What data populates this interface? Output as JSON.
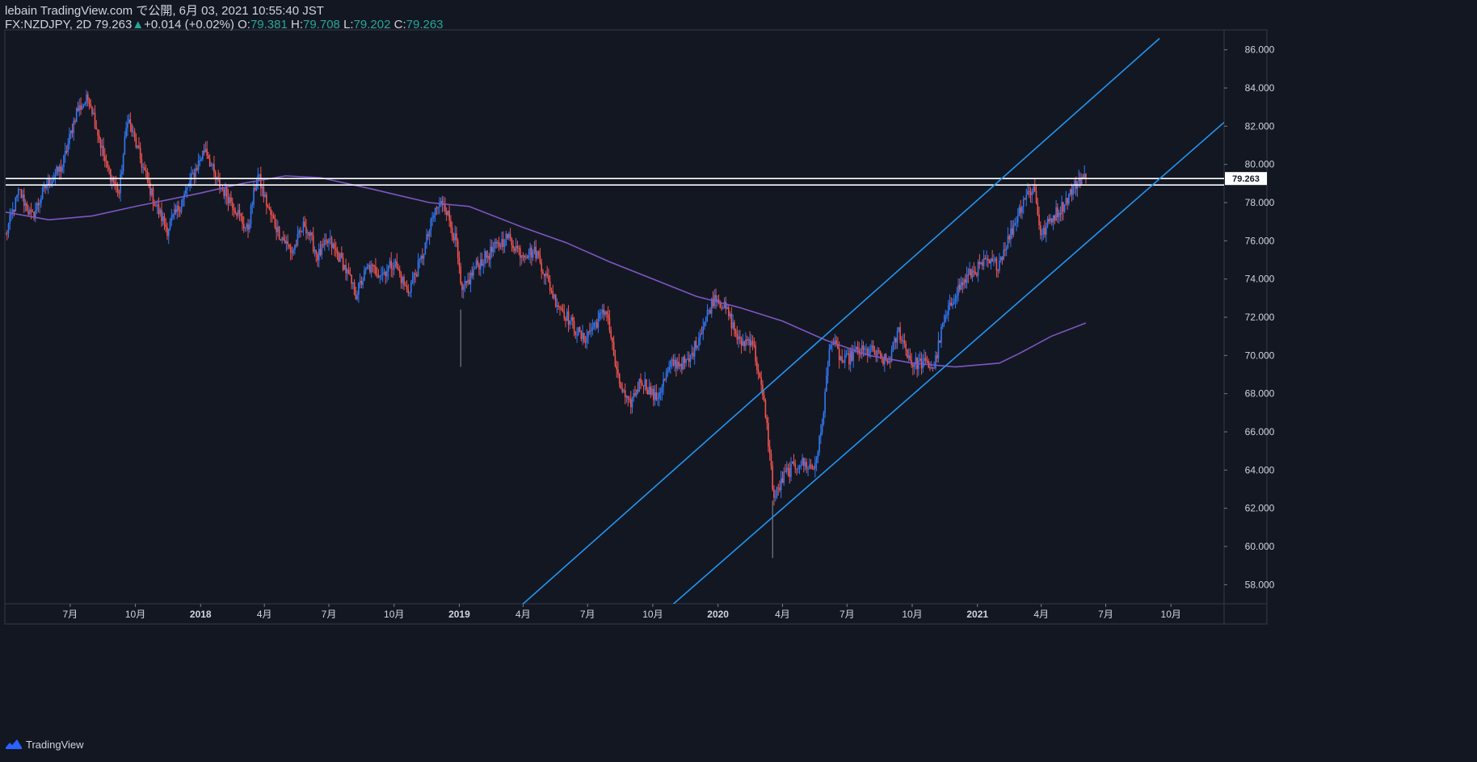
{
  "header": {
    "published": "lebain TradingView.com で公開, 6月 03, 2021 10:55:40 JST",
    "symbol": "FX:NZDJPY, 2D",
    "last": "79.263",
    "change_arrow": "▲",
    "change": "+0.014 (+0.02%)",
    "o_label": "O:",
    "o": "79.381",
    "h_label": "H:",
    "h": "79.708",
    "l_label": "L:",
    "l": "79.202",
    "c_label": "C:",
    "c": "79.263"
  },
  "footer": {
    "brand": "TradingView"
  },
  "colors": {
    "background": "#131722",
    "up": "#3179f5",
    "down": "#f0544f",
    "ma": "#7e57c2",
    "channel": "#2196f3",
    "hline": "#ffffff",
    "axis_text": "#d1d4dc",
    "value_green": "#26a69a"
  },
  "chart_data": {
    "type": "candlestick",
    "symbol": "FX:NZDJPY",
    "timeframe": "2D",
    "y_range": [
      57,
      87
    ],
    "y_ticks": [
      86,
      84,
      82,
      80,
      78,
      76,
      74,
      72,
      70,
      68,
      66,
      64,
      62,
      60,
      58
    ],
    "y_tick_labels": [
      "86.000",
      "84.000",
      "82.000",
      "80.000",
      "78.000",
      "76.000",
      "74.000",
      "72.000",
      "70.000",
      "68.000",
      "66.000",
      "64.000",
      "62.000",
      "60.000",
      "58.000"
    ],
    "x_range": [
      "2017-04-01",
      "2021-12-15"
    ],
    "x_ticks": [
      {
        "date": "2017-07-01",
        "label": "7月",
        "bold": false
      },
      {
        "date": "2017-10-01",
        "label": "10月",
        "bold": false
      },
      {
        "date": "2018-01-01",
        "label": "2018",
        "bold": true
      },
      {
        "date": "2018-04-01",
        "label": "4月",
        "bold": false
      },
      {
        "date": "2018-07-01",
        "label": "7月",
        "bold": false
      },
      {
        "date": "2018-10-01",
        "label": "10月",
        "bold": false
      },
      {
        "date": "2019-01-01",
        "label": "2019",
        "bold": true
      },
      {
        "date": "2019-04-01",
        "label": "4月",
        "bold": false
      },
      {
        "date": "2019-07-01",
        "label": "7月",
        "bold": false
      },
      {
        "date": "2019-10-01",
        "label": "10月",
        "bold": false
      },
      {
        "date": "2020-01-01",
        "label": "2020",
        "bold": true
      },
      {
        "date": "2020-04-01",
        "label": "4月",
        "bold": false
      },
      {
        "date": "2020-07-01",
        "label": "7月",
        "bold": false
      },
      {
        "date": "2020-10-01",
        "label": "10月",
        "bold": false
      },
      {
        "date": "2021-01-01",
        "label": "2021",
        "bold": true
      },
      {
        "date": "2021-04-01",
        "label": "4月",
        "bold": false
      },
      {
        "date": "2021-07-01",
        "label": "7月",
        "bold": false
      },
      {
        "date": "2021-10-01",
        "label": "10月",
        "bold": false
      }
    ],
    "price_path": [
      [
        "2017-04-01",
        76.3
      ],
      [
        "2017-04-20",
        78.6
      ],
      [
        "2017-05-08",
        77.2
      ],
      [
        "2017-05-28",
        78.9
      ],
      [
        "2017-06-20",
        79.9
      ],
      [
        "2017-07-10",
        82.8
      ],
      [
        "2017-07-28",
        83.5
      ],
      [
        "2017-08-20",
        80.0
      ],
      [
        "2017-09-08",
        78.5
      ],
      [
        "2017-09-20",
        82.5
      ],
      [
        "2017-10-12",
        79.8
      ],
      [
        "2017-10-28",
        78.0
      ],
      [
        "2017-11-15",
        76.6
      ],
      [
        "2017-12-05",
        78.0
      ],
      [
        "2017-12-22",
        79.5
      ],
      [
        "2018-01-08",
        80.9
      ],
      [
        "2018-01-22",
        79.2
      ],
      [
        "2018-02-15",
        78.0
      ],
      [
        "2018-03-08",
        76.5
      ],
      [
        "2018-03-22",
        79.5
      ],
      [
        "2018-04-08",
        77.5
      ],
      [
        "2018-04-22",
        76.4
      ],
      [
        "2018-05-10",
        75.4
      ],
      [
        "2018-05-28",
        76.9
      ],
      [
        "2018-06-15",
        75.2
      ],
      [
        "2018-07-01",
        76.0
      ],
      [
        "2018-07-20",
        74.9
      ],
      [
        "2018-08-08",
        73.2
      ],
      [
        "2018-08-25",
        74.6
      ],
      [
        "2018-09-15",
        74.3
      ],
      [
        "2018-10-01",
        74.9
      ],
      [
        "2018-10-20",
        73.3
      ],
      [
        "2018-11-08",
        75.0
      ],
      [
        "2018-11-28",
        77.6
      ],
      [
        "2018-12-10",
        78.1
      ],
      [
        "2018-12-28",
        75.8
      ],
      [
        "2019-01-04",
        73.2
      ],
      [
        "2019-01-25",
        74.7
      ],
      [
        "2019-02-20",
        75.6
      ],
      [
        "2019-03-10",
        76.2
      ],
      [
        "2019-03-28",
        75.4
      ],
      [
        "2019-04-20",
        75.4
      ],
      [
        "2019-05-15",
        73.0
      ],
      [
        "2019-06-08",
        71.7
      ],
      [
        "2019-06-25",
        70.8
      ],
      [
        "2019-07-12",
        71.7
      ],
      [
        "2019-07-28",
        72.4
      ],
      [
        "2019-08-12",
        68.8
      ],
      [
        "2019-08-28",
        67.3
      ],
      [
        "2019-09-15",
        68.8
      ],
      [
        "2019-10-05",
        67.7
      ],
      [
        "2019-10-28",
        69.6
      ],
      [
        "2019-11-20",
        69.6
      ],
      [
        "2019-12-10",
        71.5
      ],
      [
        "2019-12-28",
        73.2
      ],
      [
        "2020-01-15",
        72.2
      ],
      [
        "2020-02-01",
        70.6
      ],
      [
        "2020-02-18",
        70.9
      ],
      [
        "2020-03-08",
        67.0
      ],
      [
        "2020-03-20",
        62.5
      ],
      [
        "2020-04-05",
        63.8
      ],
      [
        "2020-04-25",
        64.4
      ],
      [
        "2020-05-15",
        64.1
      ],
      [
        "2020-05-25",
        65.8
      ],
      [
        "2020-06-08",
        70.9
      ],
      [
        "2020-06-25",
        69.6
      ],
      [
        "2020-07-15",
        70.2
      ],
      [
        "2020-08-05",
        70.2
      ],
      [
        "2020-08-28",
        69.6
      ],
      [
        "2020-09-12",
        71.3
      ],
      [
        "2020-09-30",
        69.6
      ],
      [
        "2020-10-15",
        69.6
      ],
      [
        "2020-11-01",
        69.4
      ],
      [
        "2020-11-12",
        71.4
      ],
      [
        "2020-12-01",
        73.3
      ],
      [
        "2020-12-20",
        74.2
      ],
      [
        "2021-01-10",
        74.8
      ],
      [
        "2021-01-30",
        74.8
      ],
      [
        "2021-02-18",
        76.5
      ],
      [
        "2021-03-08",
        78.3
      ],
      [
        "2021-03-22",
        78.8
      ],
      [
        "2021-04-01",
        76.2
      ],
      [
        "2021-04-15",
        77.2
      ],
      [
        "2021-05-01",
        77.8
      ],
      [
        "2021-05-15",
        78.7
      ],
      [
        "2021-05-25",
        79.3
      ],
      [
        "2021-06-03",
        79.263
      ]
    ],
    "spikes": [
      {
        "date": "2019-01-03",
        "low": 69.4
      },
      {
        "date": "2020-03-18",
        "low": 59.4
      }
    ],
    "moving_average": [
      [
        "2017-04-01",
        77.5
      ],
      [
        "2017-06-01",
        77.1
      ],
      [
        "2017-08-01",
        77.3
      ],
      [
        "2017-10-01",
        77.8
      ],
      [
        "2018-01-01",
        78.5
      ],
      [
        "2018-03-01",
        79.0
      ],
      [
        "2018-05-01",
        79.4
      ],
      [
        "2018-06-20",
        79.3
      ],
      [
        "2018-09-01",
        78.7
      ],
      [
        "2018-11-20",
        78.0
      ],
      [
        "2019-01-15",
        77.8
      ],
      [
        "2019-04-01",
        76.7
      ],
      [
        "2019-06-01",
        75.9
      ],
      [
        "2019-08-01",
        74.9
      ],
      [
        "2019-10-01",
        74.0
      ],
      [
        "2019-12-01",
        73.1
      ],
      [
        "2020-02-01",
        72.5
      ],
      [
        "2020-04-01",
        71.8
      ],
      [
        "2020-06-01",
        70.8
      ],
      [
        "2020-08-01",
        70.0
      ],
      [
        "2020-10-01",
        69.6
      ],
      [
        "2020-12-01",
        69.4
      ],
      [
        "2021-02-01",
        69.6
      ],
      [
        "2021-03-01",
        70.1
      ],
      [
        "2021-04-15",
        71.0
      ],
      [
        "2021-06-03",
        71.7
      ]
    ],
    "horizontal_lines": [
      79.26,
      78.92
    ],
    "channel_lines": [
      [
        [
          "2019-03-20",
          56.6
        ],
        [
          "2021-09-15",
          86.6
        ]
      ],
      [
        [
          "2019-10-18",
          56.6
        ],
        [
          "2021-12-15",
          82.2
        ]
      ]
    ],
    "last_price_label": "79.263"
  }
}
